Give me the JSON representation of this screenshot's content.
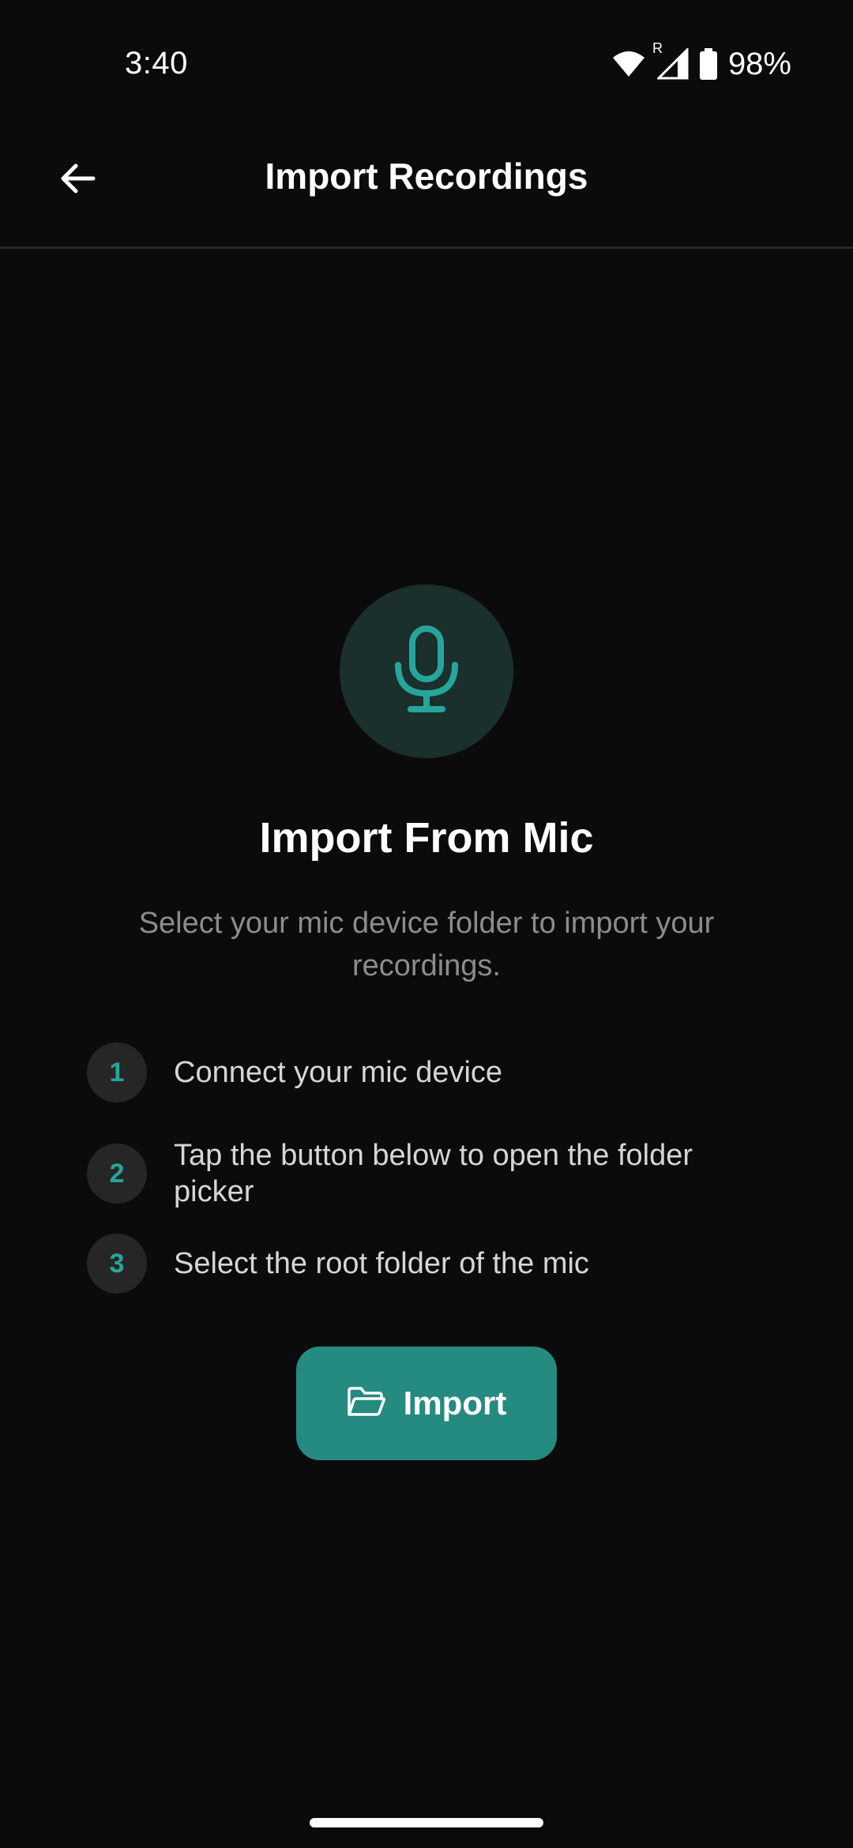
{
  "status_bar": {
    "time": "3:40",
    "network_badge": "R",
    "battery_percent": "98%"
  },
  "app_bar": {
    "title": "Import Recordings",
    "back_icon": "arrow-left-icon"
  },
  "main": {
    "icon": "microphone-icon",
    "heading": "Import From Mic",
    "description": "Select your mic device folder to import your recordings.",
    "steps": [
      {
        "number": "1",
        "text": "Connect your mic device"
      },
      {
        "number": "2",
        "text": "Tap the button below to open the folder picker"
      },
      {
        "number": "3",
        "text": "Select the root folder of the mic"
      }
    ],
    "import_button": {
      "label": "Import",
      "icon": "folder-open-icon"
    }
  },
  "colors": {
    "background": "#0b0b0b",
    "accent": "#26a69a",
    "button": "#258a80",
    "icon_circle": "#1b2f2c",
    "step_circle": "#262626",
    "muted_text": "#8c8c8c"
  }
}
